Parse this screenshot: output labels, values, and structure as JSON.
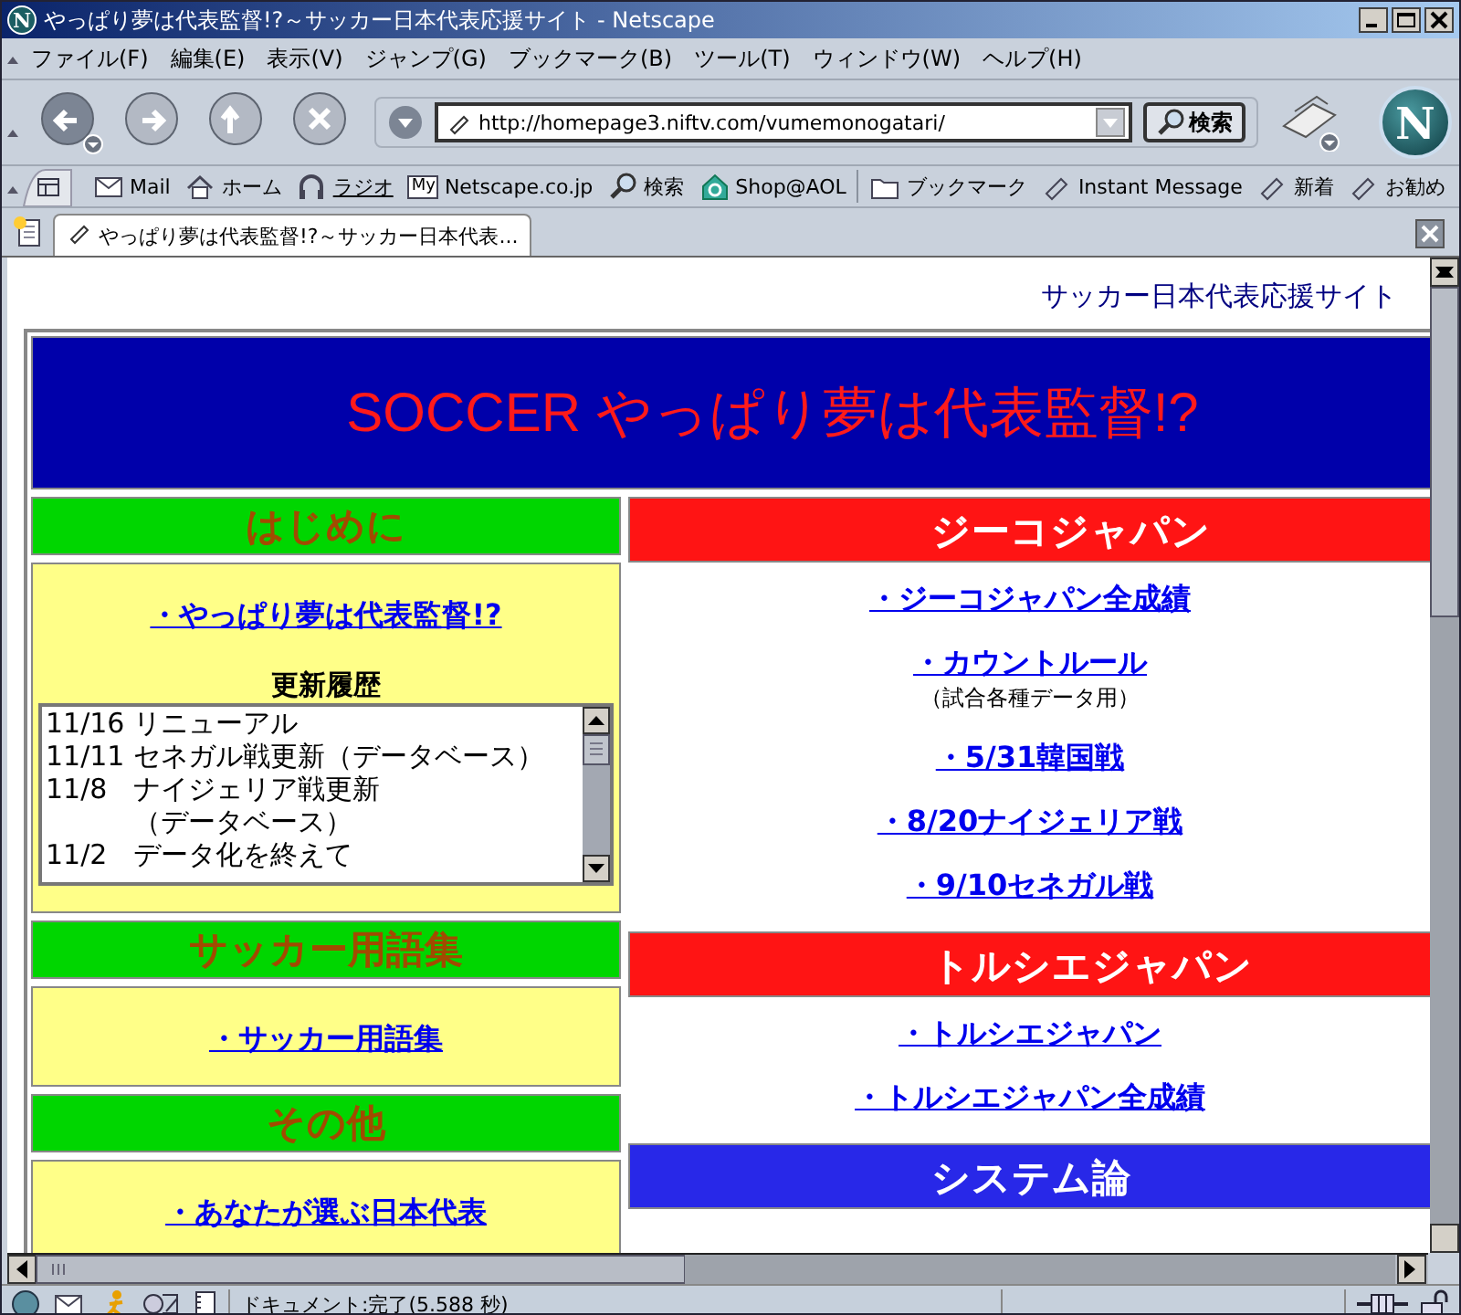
{
  "window": {
    "icon_letter": "N",
    "title": "やっぱり夢は代表監督!?～サッカー日本代表応援サイト - Netscape"
  },
  "menu": [
    "ファイル(F)",
    "編集(E)",
    "表示(V)",
    "ジャンプ(G)",
    "ブックマーク(B)",
    "ツール(T)",
    "ウィンドウ(W)",
    "ヘルプ(H)"
  ],
  "nav": {
    "url": "http://homepage3.niftv.com/vumemonogatari/",
    "search_button": "検索",
    "logo_letter": "N"
  },
  "personal_toolbar": [
    {
      "label": "Mail",
      "kind": "mail"
    },
    {
      "label": "ホーム",
      "kind": "home"
    },
    {
      "label": "ラジオ",
      "kind": "radio"
    },
    {
      "label": "Netscape.co.jp",
      "kind": "my",
      "badge": "My"
    },
    {
      "label": "検索",
      "kind": "search"
    },
    {
      "label": "Shop@AOL",
      "kind": "shop"
    },
    {
      "label": "ブックマーク",
      "kind": "folder"
    },
    {
      "label": "Instant Message",
      "kind": "bookmark"
    },
    {
      "label": "新着",
      "kind": "bookmark"
    },
    {
      "label": "お勧め",
      "kind": "bookmark"
    }
  ],
  "tabs": [
    {
      "label": "やっぱり夢は代表監督!?～サッカー日本代表...",
      "selected": true
    }
  ],
  "page": {
    "tagline": "サッカー日本代表応援サイト",
    "banner": "SOCCER やっぱり夢は代表監督!?",
    "left_sections": [
      {
        "heading": "はじめに",
        "links": [
          "・やっぱり夢は代表監督!?"
        ],
        "history": {
          "title": "更新履歴",
          "entries": [
            {
              "date": "11/16",
              "text": "リニューアル"
            },
            {
              "date": "11/11",
              "text": "セネガル戦更新（データベース）"
            },
            {
              "date": "11/8",
              "text": "ナイジェリア戦更新（データベース）"
            },
            {
              "date": "11/2",
              "text": "データ化を終えて"
            }
          ]
        }
      },
      {
        "heading": "サッカー用語集",
        "links": [
          "・サッカー用語集"
        ]
      },
      {
        "heading": "その他",
        "links": [
          "・あなたが選ぶ日本代表"
        ]
      }
    ],
    "right_sections": [
      {
        "heading": "ジーコジャパン",
        "color": "#ff1414",
        "links": [
          {
            "text": "・ジーコジャパン全成績"
          },
          {
            "text": "・カウントルール",
            "note": "（試合各種データ用）"
          },
          {
            "text": "・5/31韓国戦"
          },
          {
            "text": "・8/20ナイジェリア戦"
          },
          {
            "text": "・9/10セネガル戦"
          }
        ]
      },
      {
        "heading": "トルシエジャパン",
        "color": "#ff1414",
        "links": [
          {
            "text": "・トルシエジャパン"
          },
          {
            "text": "・トルシエジャパン全成績"
          }
        ]
      },
      {
        "heading": "システム論",
        "color": "#2828e8"
      }
    ]
  },
  "status_bar": {
    "text": "ドキュメント:完了(5.588 秒)"
  }
}
